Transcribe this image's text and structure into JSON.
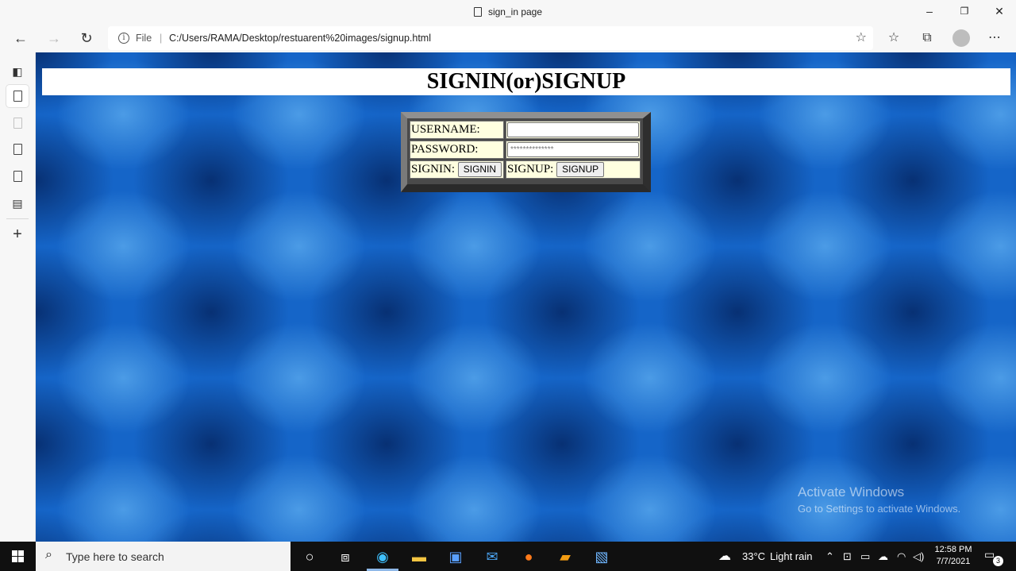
{
  "browser": {
    "window_title": "sign_in page",
    "controls": {
      "minimize": "–",
      "maximize": "❐",
      "close": "✕"
    },
    "address": {
      "scheme_label": "File",
      "separator": "|",
      "url": "C:/Users/RAMA/Desktop/restuarent%20images/signup.html"
    }
  },
  "page": {
    "heading": "SIGNIN(or)SIGNUP",
    "form": {
      "username_label": "USERNAME:",
      "username_value": "",
      "password_label": "PASSWORD:",
      "password_placeholder": "**************",
      "signin_label": "SIGNIN:",
      "signin_button": "SIGNIN",
      "signup_label": "SIGNUP:",
      "signup_button": "SIGNUP"
    },
    "watermark": {
      "line1": "Activate Windows",
      "line2": "Go to Settings to activate Windows."
    }
  },
  "taskbar": {
    "search_placeholder": "Type here to search",
    "weather_temp": "33°C",
    "weather_desc": "Light rain",
    "time": "12:58 PM",
    "date": "7/7/2021",
    "notification_count": "3"
  },
  "colors": {
    "page_background": "#1565c8",
    "form_cell": "#ffffe0",
    "taskbar": "#101010"
  }
}
